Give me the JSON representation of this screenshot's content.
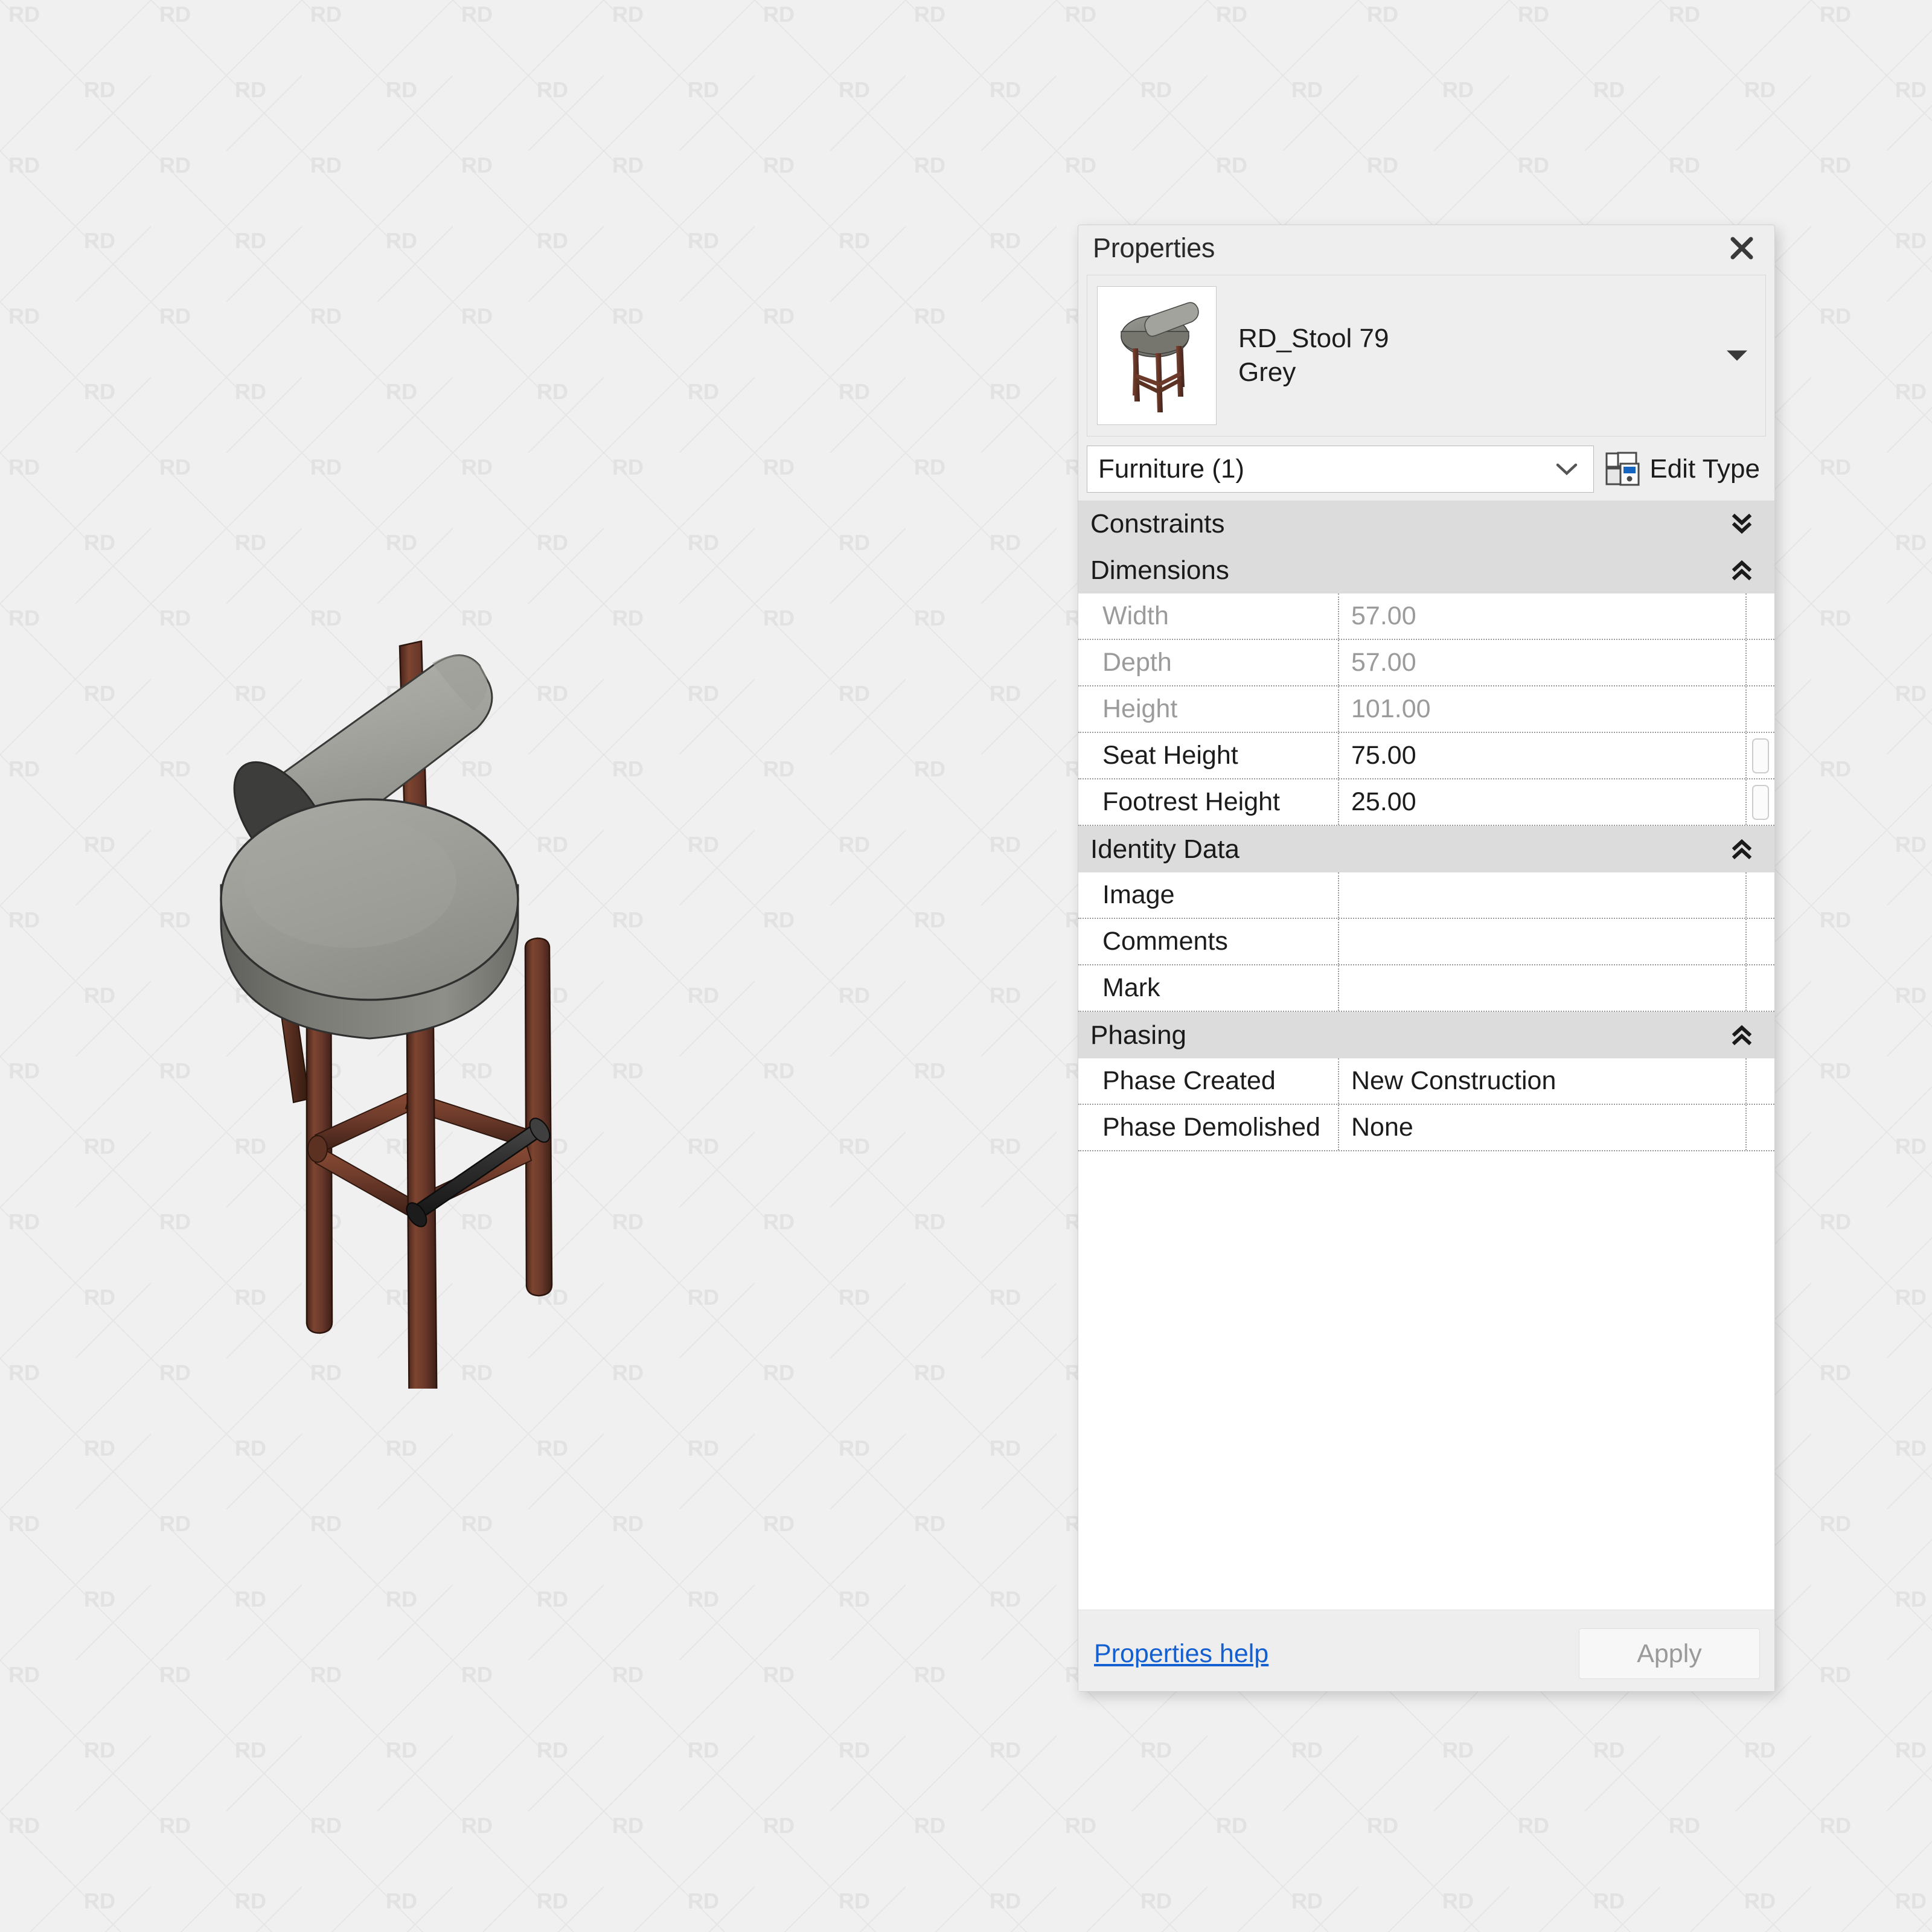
{
  "background": {
    "watermark_text": "RD",
    "base_color": "#f0f0f0",
    "watermark_color": "#e2e2e2",
    "hatch_color": "#e6e6e6"
  },
  "viewport": {
    "object_name": "RD_Stool 79",
    "materials": {
      "upholstery_grey": "#9a9a95",
      "upholstery_shadow": "#6f6f6a",
      "wood_leg": "#6b3a2a",
      "wood_leg_light": "#8c5238",
      "metal_black": "#2d2d2d"
    }
  },
  "panel": {
    "title": "Properties",
    "close_icon": "close-icon",
    "type_preview": {
      "family": "RD_Stool 79",
      "type": "Grey",
      "dropdown_icon": "caret-down-icon",
      "thumbnail_icon": "stool-thumbnail"
    },
    "category_selector": {
      "value": "Furniture (1)",
      "chevron_icon": "chevron-down-icon"
    },
    "edit_type": {
      "label": "Edit Type",
      "icon": "edit-type-icon"
    },
    "groups": [
      {
        "label": "Constraints",
        "state": "collapsed",
        "toggle_icon": "double-chevron-down-icon",
        "rows": []
      },
      {
        "label": "Dimensions",
        "state": "expanded",
        "toggle_icon": "double-chevron-up-icon",
        "rows": [
          {
            "name": "Width",
            "value": "57.00",
            "disabled": true,
            "has_button": false
          },
          {
            "name": "Depth",
            "value": "57.00",
            "disabled": true,
            "has_button": false
          },
          {
            "name": "Height",
            "value": "101.00",
            "disabled": true,
            "has_button": false
          },
          {
            "name": "Seat Height",
            "value": "75.00",
            "disabled": false,
            "has_button": true
          },
          {
            "name": "Footrest Height",
            "value": "25.00",
            "disabled": false,
            "has_button": true
          }
        ]
      },
      {
        "label": "Identity Data",
        "state": "expanded",
        "toggle_icon": "double-chevron-up-icon",
        "rows": [
          {
            "name": "Image",
            "value": "",
            "disabled": false,
            "has_button": false
          },
          {
            "name": "Comments",
            "value": "",
            "disabled": false,
            "has_button": false
          },
          {
            "name": "Mark",
            "value": "",
            "disabled": false,
            "has_button": false
          }
        ]
      },
      {
        "label": "Phasing",
        "state": "expanded",
        "toggle_icon": "double-chevron-up-icon",
        "rows": [
          {
            "name": "Phase Created",
            "value": "New Construction",
            "disabled": false,
            "has_button": false
          },
          {
            "name": "Phase Demolished",
            "value": "None",
            "disabled": false,
            "has_button": false
          }
        ]
      }
    ],
    "footer": {
      "help_label": "Properties help",
      "apply_label": "Apply",
      "link_color": "#1560d0"
    }
  }
}
